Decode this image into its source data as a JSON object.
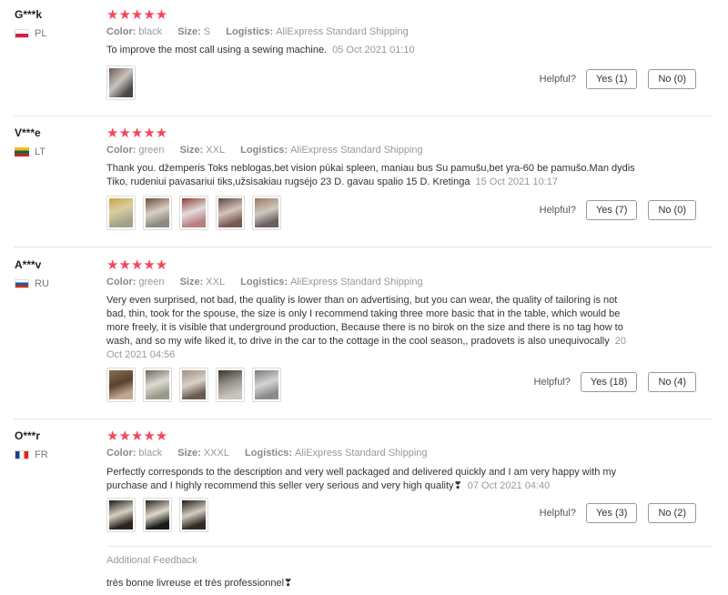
{
  "labels": {
    "color": "Color:",
    "size": "Size:",
    "logistics": "Logistics:",
    "helpful": "Helpful?",
    "additional_feedback": "Additional Feedback"
  },
  "stars": "★★★★★",
  "reviews": [
    {
      "user": "G***k",
      "country": "PL",
      "color": "black",
      "size": "S",
      "logistics": "AliExpress Standard Shipping",
      "text": "To improve the most call using a sewing machine.",
      "date": "05 Oct 2021 01:10",
      "yes": "Yes (1)",
      "no": "No (0)"
    },
    {
      "user": "V***e",
      "country": "LT",
      "color": "green",
      "size": "XXL",
      "logistics": "AliExpress Standard Shipping",
      "text": "Thank you. džemperis Toks neblogas,bet vision pūkai spleen, maniau bus Su pamušu,bet yra-60 be pamušo.Man dydis Tiko, rudeniui pavasariui tiks,užsisakiau rugsėjo 23 D. gavau spalio 15 D. Kretinga",
      "date": "15 Oct 2021 10:17",
      "yes": "Yes (7)",
      "no": "No (0)"
    },
    {
      "user": "A***v",
      "country": "RU",
      "color": "green",
      "size": "XXL",
      "logistics": "AliExpress Standard Shipping",
      "text": "Very even surprised, not bad, the quality is lower than on advertising, but you can wear, the quality of tailoring is not bad, thin, took for the spouse, the size is only I recommend taking three more basic that in the table, which would be more freely, it is visible that underground production, Because there is no birok on the size and there is no tag how to wash, and so my wife liked it, to drive in the car to the cottage in the cool season,, pradovets is also unequivocally",
      "date": "20 Oct 2021 04:56",
      "yes": "Yes (18)",
      "no": "No (4)"
    },
    {
      "user": "O***r",
      "country": "FR",
      "color": "black",
      "size": "XXXL",
      "logistics": "AliExpress Standard Shipping",
      "text": "Perfectly corresponds to the description and very well packaged and delivered quickly and I am very happy with my purchase and I highly recommend this seller very serious and very high quality❣",
      "date": "07 Oct 2021 04:40",
      "yes": "Yes (3)",
      "no": "No (2)",
      "additional": "très bonne livreuse et très professionnel❣"
    }
  ]
}
